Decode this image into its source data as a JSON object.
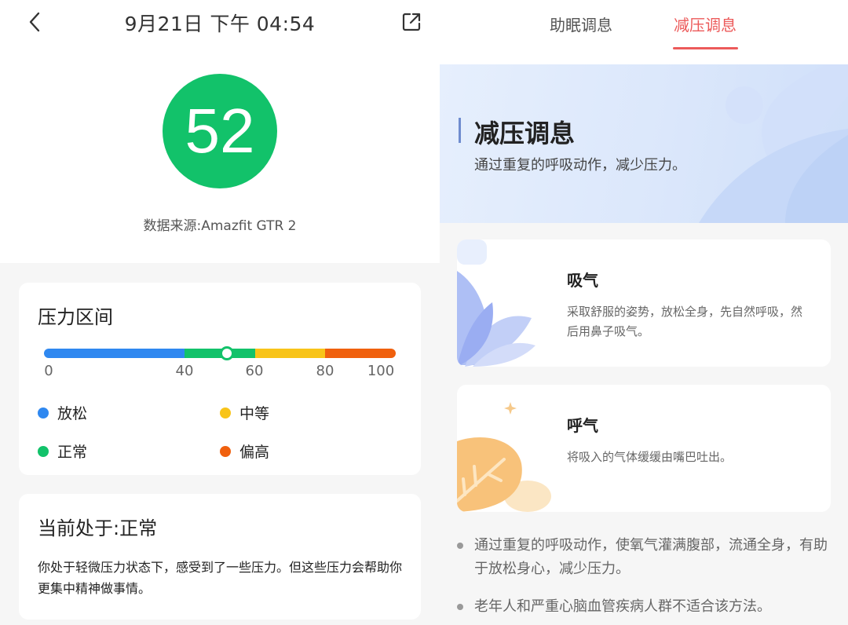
{
  "left": {
    "header": {
      "title": "9月21日 下午 04:54"
    },
    "score": {
      "value": "52"
    },
    "source": "数据来源:Amazfit GTR 2",
    "range_card": {
      "title": "压力区间",
      "marker_value": 52,
      "range_max": 100,
      "ticks": [
        "0",
        "40",
        "60",
        "80",
        "100"
      ],
      "legend": [
        {
          "label": "放松",
          "color": "#2f88f0"
        },
        {
          "label": "中等",
          "color": "#f8c419"
        },
        {
          "label": "正常",
          "color": "#12c26a"
        },
        {
          "label": "偏高",
          "color": "#f0600e"
        }
      ]
    },
    "status_card": {
      "title": "当前处于:正常",
      "description": "你处于轻微压力状态下，感受到了一些压力。但这些压力会帮助你更集中精神做事情。"
    }
  },
  "right": {
    "tabs": [
      {
        "label": "助眠调息",
        "active": false
      },
      {
        "label": "减压调息",
        "active": true
      }
    ],
    "banner": {
      "title": "减压调息",
      "subtitle": "通过重复的呼吸动作，减少压力。"
    },
    "steps": [
      {
        "title": "吸气",
        "description": "采取舒服的姿势，放松全身，先自然呼吸，然后用鼻子吸气。"
      },
      {
        "title": "呼气",
        "description": "将吸入的气体缓缓由嘴巴吐出。"
      }
    ],
    "notes": [
      "通过重复的呼吸动作，使氧气灌满腹部，流通全身，有助于放松身心，减少压力。",
      "老年人和严重心脑血管疾病人群不适合该方法。"
    ]
  },
  "colors": {
    "accent_green": "#12c26a",
    "accent_red": "#ec5a5a"
  }
}
